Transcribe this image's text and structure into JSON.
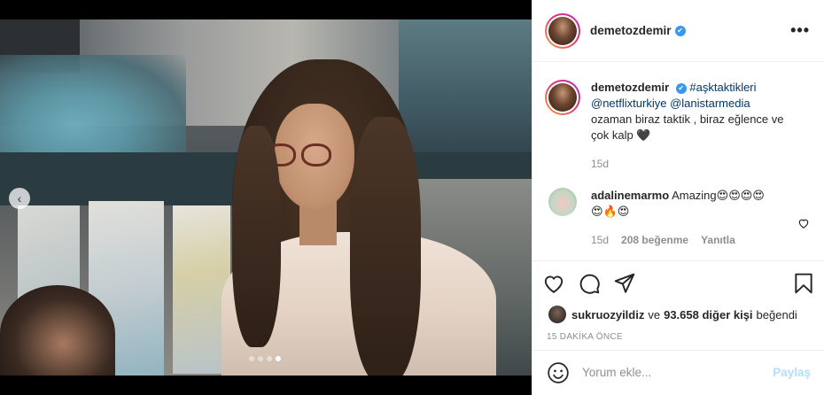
{
  "post": {
    "username": "demetozdemir",
    "verified": true
  },
  "caption": {
    "username": "demetozdemir",
    "hashtag": "#aşktaktikleri",
    "mention1": "@netflixturkiye",
    "mention2": "@lanistarmedia",
    "text_line1": "ozaman biraz taktik , biraz eğlence ve",
    "text_line2": "çok kalp 🖤",
    "age": "15d"
  },
  "comment": {
    "username": "adalinemarmo",
    "text": "Amazing😍😍😍😍",
    "text_line2": "😍🔥😍",
    "age": "15d",
    "likes": "208 beğenme",
    "reply": "Yanıtla"
  },
  "likes": {
    "user": "sukruozyildiz",
    "connector": "ve",
    "others": "93.658 diğer kişi",
    "suffix": "beğendi"
  },
  "timeago": "15 DAKİKA ÖNCE",
  "composer": {
    "placeholder": "Yorum ekle...",
    "post_label": "Paylaş"
  },
  "carousel": {
    "total": 4,
    "active_index": 3
  },
  "icons": {
    "prev": "chevron-left-icon",
    "more": "more-options-icon",
    "like": "heart-icon",
    "comment": "comment-icon",
    "share": "share-icon",
    "save": "bookmark-icon",
    "emoji": "emoji-icon"
  }
}
